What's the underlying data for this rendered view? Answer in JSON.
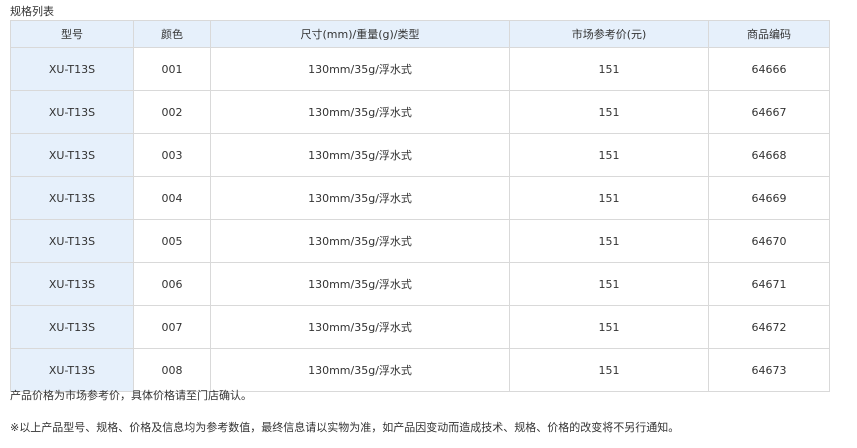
{
  "section_title": "规格列表",
  "table": {
    "headers": [
      "型号",
      "颜色",
      "尺寸(mm)/重量(g)/类型",
      "市场参考价(元)",
      "商品编码"
    ],
    "rows": [
      [
        "XU-T13S",
        "001",
        "130mm/35g/浮水式",
        "151",
        "64666"
      ],
      [
        "XU-T13S",
        "002",
        "130mm/35g/浮水式",
        "151",
        "64667"
      ],
      [
        "XU-T13S",
        "003",
        "130mm/35g/浮水式",
        "151",
        "64668"
      ],
      [
        "XU-T13S",
        "004",
        "130mm/35g/浮水式",
        "151",
        "64669"
      ],
      [
        "XU-T13S",
        "005",
        "130mm/35g/浮水式",
        "151",
        "64670"
      ],
      [
        "XU-T13S",
        "006",
        "130mm/35g/浮水式",
        "151",
        "64671"
      ],
      [
        "XU-T13S",
        "007",
        "130mm/35g/浮水式",
        "151",
        "64672"
      ],
      [
        "XU-T13S",
        "008",
        "130mm/35g/浮水式",
        "151",
        "64673"
      ]
    ]
  },
  "notes": [
    "产品价格为市场参考价，具体价格请至门店确认。",
    "※以上产品型号、规格、价格及信息均为参考数值，最终信息请以实物为准，如产品因变动而造成技术、规格、价格的改变将不另行通知。"
  ],
  "colors": {
    "header_bg": "#e6f0fb",
    "border": "#d9d9d9",
    "text": "#333333"
  }
}
